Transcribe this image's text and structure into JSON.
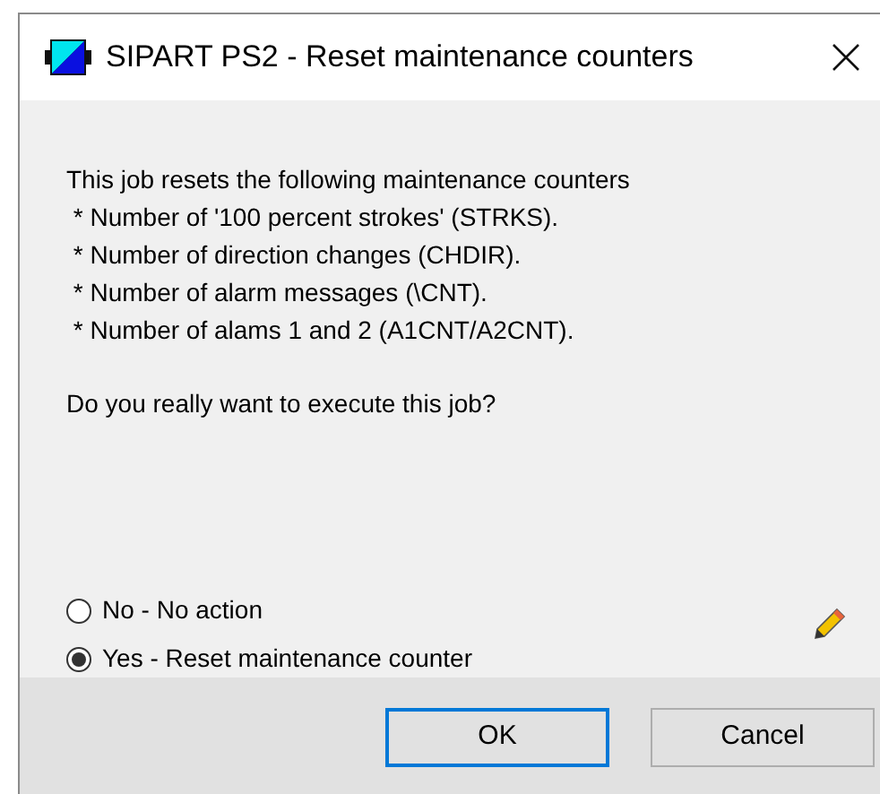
{
  "window": {
    "title": "SIPART PS2 - Reset maintenance counters"
  },
  "description": [
    "This job resets the following maintenance counters",
    " * Number of '100 percent strokes' (STRKS).",
    " * Number of direction changes (CHDIR).",
    " * Number of alarm messages (\\CNT).",
    " * Number of alams 1 and 2 (A1CNT/A2CNT)."
  ],
  "question": "Do you really want to execute this job?",
  "options": [
    {
      "label": "No - No action",
      "selected": false
    },
    {
      "label": "Yes - Reset maintenance counter",
      "selected": true
    }
  ],
  "buttons": [
    {
      "label": "OK",
      "default": true
    },
    {
      "label": "Cancel",
      "default": false
    }
  ]
}
